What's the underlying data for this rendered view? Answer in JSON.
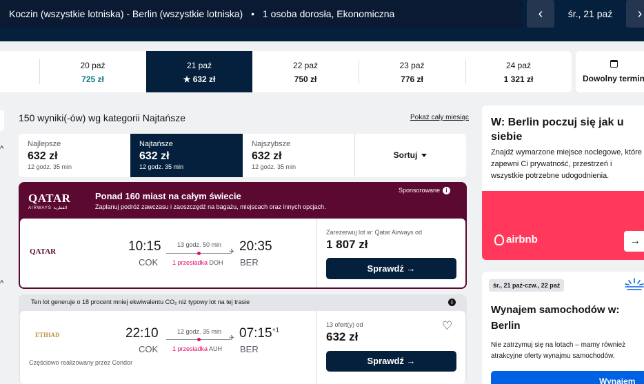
{
  "header": {
    "route": "Koczin (wszystkie lotniska) - Berlin (wszystkie lotniska)",
    "separator": "•",
    "passengers": "1 osoba dorosła, Ekonomiczna",
    "prev_icon": "‹",
    "next_icon": "›",
    "selected_date": "śr., 21 paź"
  },
  "dates": [
    {
      "date": "20 paź",
      "price": "725 zł",
      "cheap": true
    },
    {
      "date": "21 paź",
      "price": "★ 632 zł",
      "selected": true
    },
    {
      "date": "22 paź",
      "price": "750 zł"
    },
    {
      "date": "23 paź",
      "price": "776 zł"
    },
    {
      "date": "24 paź",
      "price": "1 321 zł"
    }
  ],
  "anytime": "Dowolny termin",
  "results": {
    "count": "150 wyniki(-ów) wg kategorii Najtańsze",
    "whole_month": "Pokaż cały miesiąc"
  },
  "sort_tabs": [
    {
      "label": "Najlepsze",
      "price": "632 zł",
      "duration": "12 godz. 35 min"
    },
    {
      "label": "Najtańsze",
      "price": "632 zł",
      "duration": "12 godz. 35 min",
      "selected": true
    },
    {
      "label": "Najszybsze",
      "price": "632 zł",
      "duration": "12 godz. 35 min"
    }
  ],
  "sort_button": "Sortuj",
  "sponsored": {
    "logo": "QATAR",
    "logo_sub": "AIRWAYS القطرية",
    "title": "Ponad 160 miast na całym świecie",
    "subtitle": "Zaplanuj podróż zawczasu i zaoszczędź na bagażu, miejscach oraz innych opcjach.",
    "tag": "Sponsorowane",
    "info_icon": "i",
    "flight": {
      "logo": "QATAR",
      "dep_time": "10:15",
      "dep_code": "COK",
      "duration": "13 godz. 50 min",
      "stops": "1 przesiadka",
      "stop_code": "DOH",
      "arr_time": "20:35",
      "arr_code": "BER",
      "offer_label": "Zarezerwuj lot w: Qatar Airways od",
      "price": "1 807 zł",
      "button": "Sprawdź →"
    }
  },
  "eco_banner": {
    "text": "Ten lot generuje o 18 procent mniej ekwiwalentu CO₂ niż typowy lot na tej trasie",
    "info_icon": "i"
  },
  "flight2": {
    "logo": "ETIHAD",
    "dep_time": "22:10",
    "dep_code": "COK",
    "duration": "12 godz. 35 min",
    "stops": "1 przesiadka",
    "stop_code": "AUH",
    "arr_time": "07:15",
    "arr_plus": "+1",
    "arr_code": "BER",
    "partial": "Częściowo realizowany przez Condor",
    "offer_label": "13 ofert(y) od",
    "price": "632 zł",
    "button": "Sprawdź →",
    "heart_icon": "♡"
  },
  "ad_airbnb": {
    "title": "W: Berlin poczuj się jak u siebie",
    "body": "Znajdź wymarzone miejsce noclegowe, które zapewni Ci prywatność, przestrzeń i wszystkie potrzebne udogodnienia.",
    "brand": "airbnb",
    "arrow": "→"
  },
  "ad_cars": {
    "dates": "śr., 21 paź-czw., 22 paź",
    "title": "Wynajem samochodów w: Berlin",
    "body": "Nie zatrzymuj się na lotach – mamy również atrakcyjne oferty wynajmu samochodów.",
    "button": "Wynajem"
  },
  "colors": {
    "brand_dark": "#05203c",
    "qatar": "#5c0931",
    "airbnb": "#ff385c",
    "stop": "#e70866",
    "cheap": "#0d7b86"
  }
}
